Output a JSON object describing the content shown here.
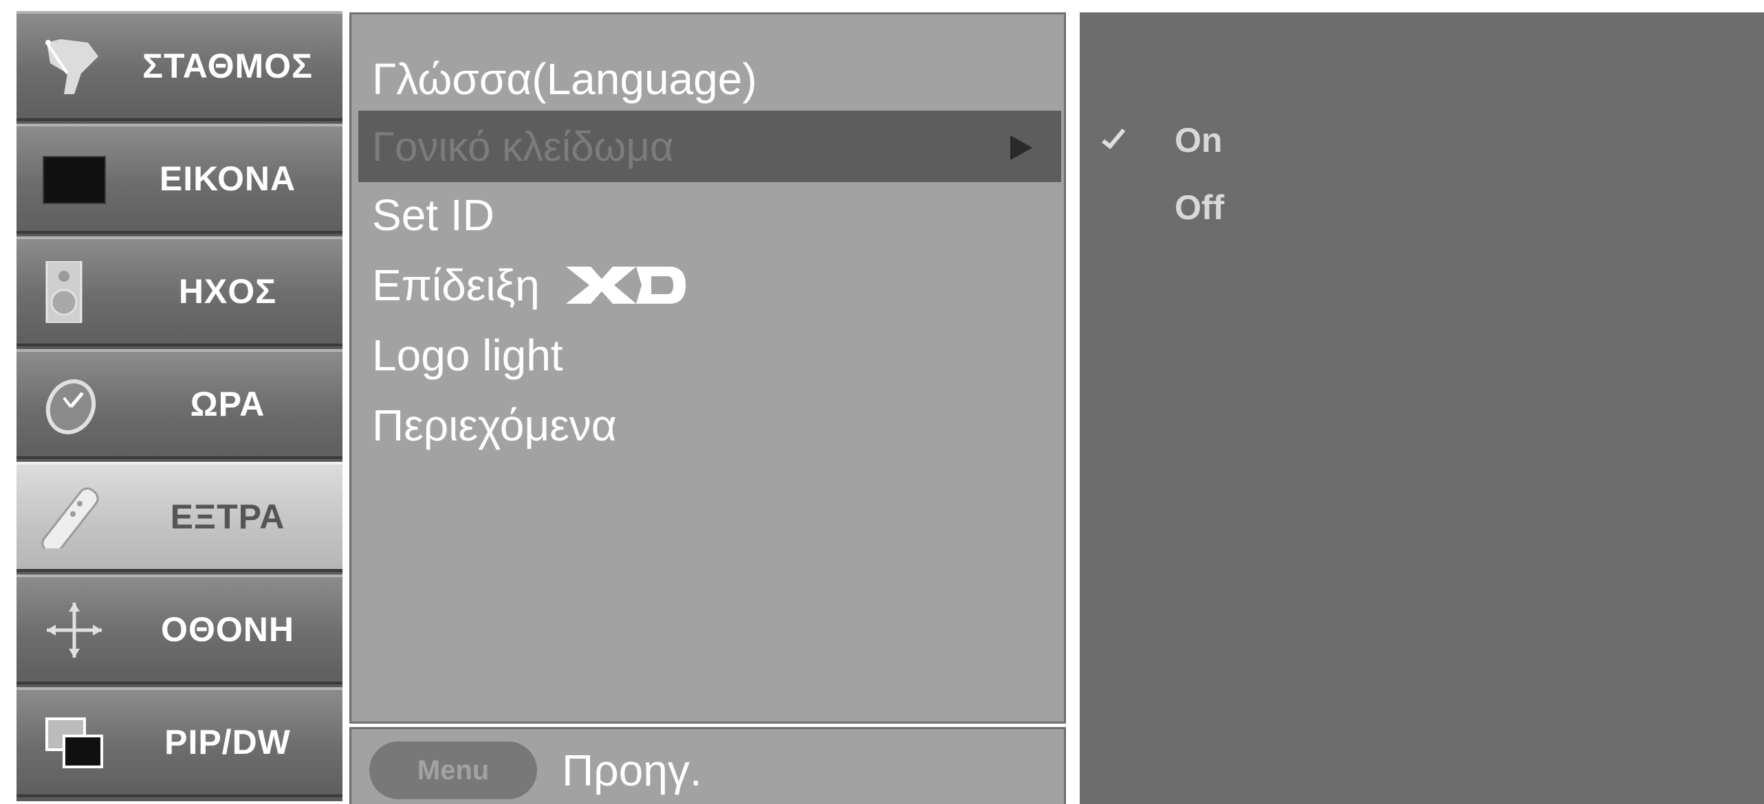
{
  "sidebar": {
    "items": [
      {
        "label": "ΣΤΑΘΜΟΣ",
        "icon": "satellite-dish-icon"
      },
      {
        "label": "ΕΙΚΟΝΑ",
        "icon": "picture-icon"
      },
      {
        "label": "ΗΧΟΣ",
        "icon": "speaker-icon"
      },
      {
        "label": "ΩΡΑ",
        "icon": "clock-icon"
      },
      {
        "label": "ΕΞΤΡΑ",
        "icon": "remote-control-icon",
        "selected": true
      },
      {
        "label": "ΟΘΟΝΗ",
        "icon": "screen-arrows-icon"
      },
      {
        "label": "PIP/DW",
        "icon": "pip-windows-icon"
      }
    ]
  },
  "submenu": {
    "items": [
      {
        "label": "Γλώσσα(Language)"
      },
      {
        "label": "Γονικό κλείδωμα",
        "selected": true
      },
      {
        "label": "Set ID"
      },
      {
        "label": "Επίδειξη",
        "badge": "XD"
      },
      {
        "label": "Logo light"
      },
      {
        "label": "Περιεχόμενα"
      }
    ]
  },
  "bottom": {
    "menu_label": "Menu",
    "back_label": "Προηγ."
  },
  "options": {
    "items": [
      {
        "label": "On",
        "checked": true
      },
      {
        "label": "Off",
        "checked": false
      }
    ]
  },
  "colors": {
    "sidebar_item": "#6d6d6d",
    "sidebar_selected": "#c3c3c3",
    "submenu_bg": "#a2a2a2",
    "highlight": "#5d5d5d",
    "options_bg": "#6d6d6d"
  }
}
